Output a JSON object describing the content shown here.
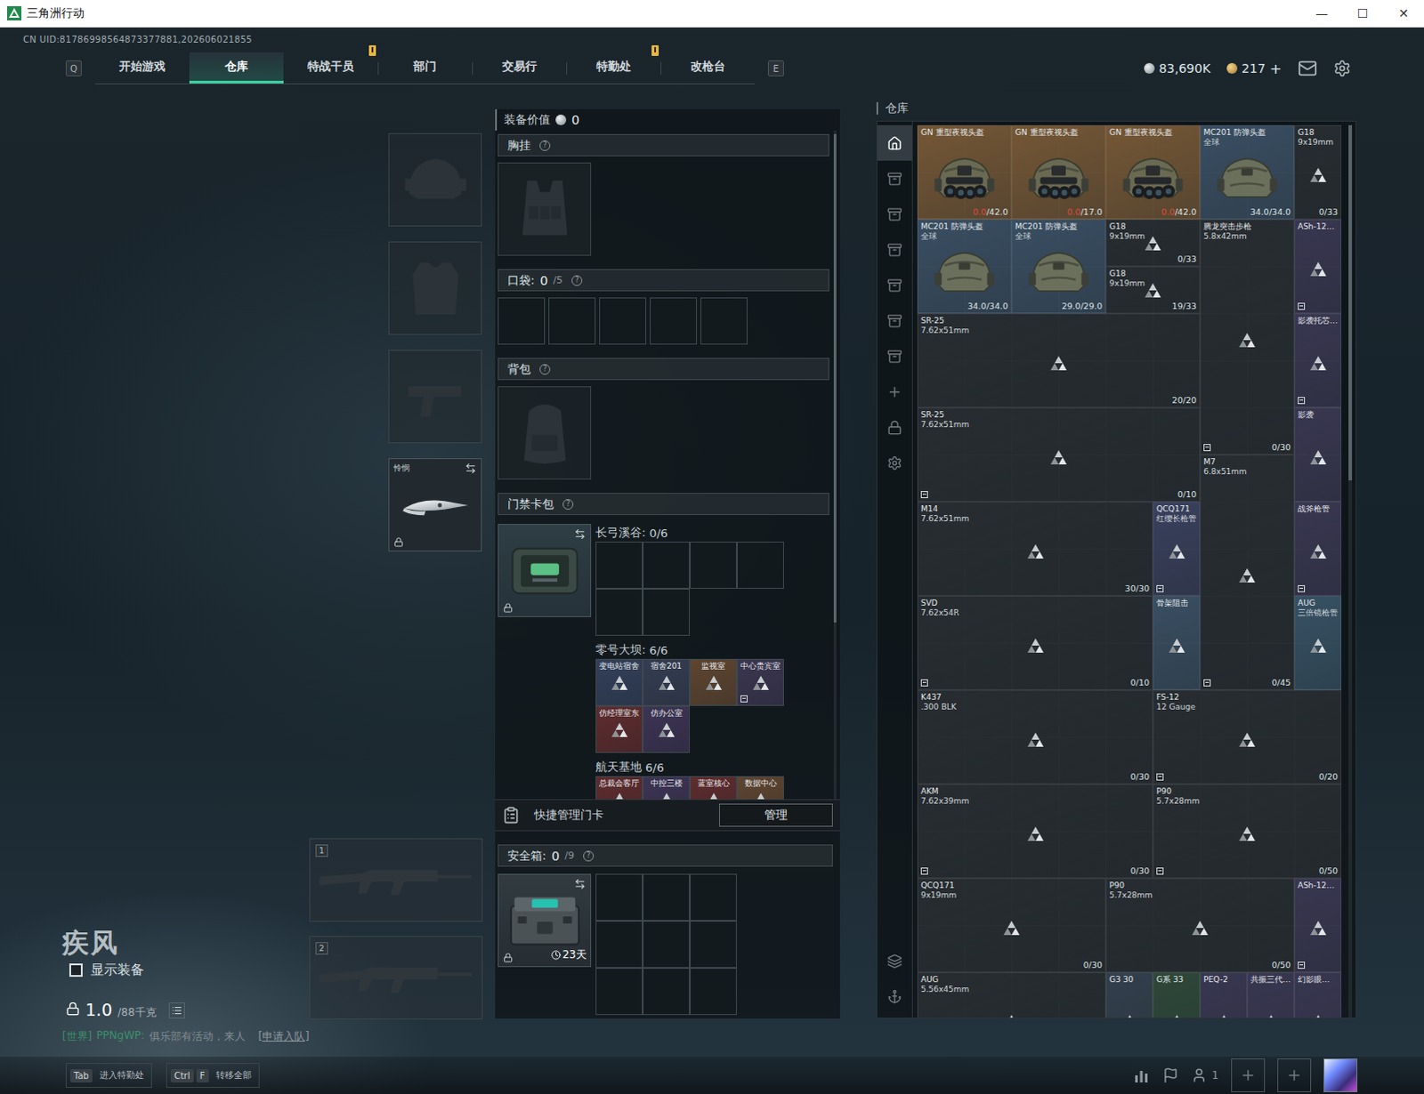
{
  "window": {
    "title": "三角洲行动",
    "controls": [
      "—",
      "☐",
      "✕"
    ]
  },
  "uid": "CN UID:81786998564873377881,202606021855",
  "nav": {
    "prev_key": "Q",
    "next_key": "E",
    "tabs": [
      {
        "label": "开始游戏",
        "selected": false,
        "alert": false
      },
      {
        "label": "仓库",
        "selected": true,
        "alert": false
      },
      {
        "label": "特战干员",
        "selected": false,
        "alert": true
      },
      {
        "label": "部门",
        "selected": false,
        "alert": false
      },
      {
        "label": "交易行",
        "selected": false,
        "alert": false
      },
      {
        "label": "特勤处",
        "selected": false,
        "alert": true
      },
      {
        "label": "改枪台",
        "selected": false,
        "alert": false
      }
    ]
  },
  "currencies": [
    {
      "kind": "silver",
      "amount": "83,690K"
    },
    {
      "kind": "gold",
      "amount": "217",
      "action": "+"
    }
  ],
  "equipment": [
    {
      "kind": "helmet"
    },
    {
      "kind": "armor"
    },
    {
      "kind": "pistol"
    },
    {
      "kind": "melee",
      "label": "怜悯",
      "locked": true
    }
  ],
  "weapons": [
    {
      "slot": "1"
    },
    {
      "slot": "2"
    }
  ],
  "character": {
    "name": "疾风",
    "show_equipment": {
      "label": "显示装备",
      "checked": false
    },
    "weight": "1.0",
    "weight_max": "/88千克",
    "locked": true
  },
  "chat": {
    "channel": "[世界]",
    "user": "PPNgWP:",
    "message": "俱乐部有活动，来人",
    "action": "[申请入队]"
  },
  "loadout": {
    "value_label": "装备价值",
    "value": "0",
    "chest_rig": {
      "label": "胸挂",
      "help": "?"
    },
    "pockets": {
      "label": "口袋:",
      "count": "0",
      "capacity": "/5",
      "help": "?",
      "slots": [
        {
          "filled": false
        },
        {
          "filled": false
        },
        {
          "filled": false
        },
        {
          "filled": false
        },
        {
          "filled": false
        }
      ]
    },
    "backpack": {
      "label": "背包",
      "help": "?"
    },
    "keycards": {
      "label": "门禁卡包",
      "help": "?",
      "locked": true,
      "maps": [
        {
          "name": "长弓溪谷:",
          "count": "0/6",
          "cards": [
            {
              "filled": false
            },
            {
              "filled": false
            },
            {
              "filled": false
            },
            {
              "filled": false
            },
            {
              "filled": false
            },
            {
              "filled": false
            }
          ]
        },
        {
          "name": "零号大坝:",
          "count": "6/6",
          "cards": [
            {
              "filled": true,
              "name": "变电站宿舍",
              "color": "#33405a",
              "marked": false
            },
            {
              "filled": true,
              "name": "宿舍201",
              "color": "#353d52",
              "marked": false
            },
            {
              "filled": true,
              "name": "监视室",
              "color": "#5e4530",
              "marked": false
            },
            {
              "filled": true,
              "name": "中心贵宾室",
              "color": "#3b3650",
              "marked": true
            },
            {
              "filled": true,
              "name": "仿经理室东",
              "color": "#5e2c2e",
              "marked": false
            },
            {
              "filled": true,
              "name": "仿办公室",
              "color": "#3d3454",
              "marked": false
            }
          ]
        },
        {
          "name": "航天基地",
          "count": "6/6",
          "cards": [
            {
              "filled": true,
              "name": "总裁会客厅",
              "color": "#5e2c2e",
              "marked": false
            },
            {
              "filled": true,
              "name": "中控三楼",
              "color": "#3d3454",
              "marked": false
            },
            {
              "filled": true,
              "name": "蓝室核心",
              "color": "#5e2c2e",
              "marked": false
            },
            {
              "filled": true,
              "name": "数据中心",
              "color": "#5e4530",
              "marked": false
            }
          ]
        }
      ]
    },
    "quick_manage": {
      "label": "快捷管理门卡",
      "button": "管理"
    },
    "safe_box": {
      "label": "安全箱:",
      "count": "0",
      "capacity": "/9",
      "help": "?",
      "days": "23天",
      "locked": true,
      "slots": [
        {
          "filled": false
        },
        {
          "filled": false
        },
        {
          "filled": false
        },
        {
          "filled": false
        },
        {
          "filled": false
        },
        {
          "filled": false
        },
        {
          "filled": false
        },
        {
          "filled": false
        },
        {
          "filled": false
        }
      ]
    }
  },
  "stash": {
    "label": "仓库",
    "tabs": [
      {
        "kind": "home",
        "selected": true
      },
      {
        "kind": "tab",
        "selected": false
      },
      {
        "kind": "tab",
        "selected": false
      },
      {
        "kind": "tab",
        "selected": false
      },
      {
        "kind": "tab",
        "selected": false
      },
      {
        "kind": "tab",
        "selected": false
      },
      {
        "kind": "tab",
        "selected": false
      },
      {
        "kind": "add",
        "selected": false
      },
      {
        "kind": "lock",
        "selected": false
      },
      {
        "kind": "settings",
        "selected": false
      },
      {
        "kind": "layers",
        "selected": false
      },
      {
        "kind": "transfer",
        "selected": false
      }
    ],
    "items": [
      {
        "name": "GN 重型夜视头盔",
        "kind": "nvg_helmet",
        "color": "#7a5a36",
        "count_low": "0.0",
        "count": "/42.0",
        "marked": false
      },
      {
        "name": "GN 重型夜视头盔",
        "kind": "nvg_helmet",
        "color": "#7a5a36",
        "count_low": "0.0",
        "count": "/17.0",
        "marked": false
      },
      {
        "name": "GN 重型夜视头盔",
        "kind": "nvg_helmet",
        "color": "#7a5a36",
        "count_low": "0.0",
        "count": "/42.0",
        "marked": false
      },
      {
        "name": "MC201 防弹头盔",
        "sub": "全球",
        "kind": "helmet",
        "color": "#3b5166",
        "count": "34.0/34.0",
        "marked": false
      },
      {
        "name": "G18",
        "sub": "9x19mm",
        "kind": "gun",
        "color": "#272d31",
        "count": "0/33",
        "marked": false
      },
      {
        "name": "MC201 防弹头盔",
        "sub": "全球",
        "kind": "helmet",
        "color": "#3b5166",
        "count": "34.0/34.0",
        "marked": false
      },
      {
        "name": "MC201 防弹头盔",
        "sub": "全球",
        "kind": "helmet",
        "color": "#3b5166",
        "count": "29.0/29.0",
        "marked": false
      },
      {
        "name": "G18",
        "sub": "9x19mm",
        "kind": "gun",
        "color": "#272d31",
        "count": "0/33",
        "marked": false
      },
      {
        "name": "G18",
        "sub": "9x19mm",
        "kind": "gun",
        "color": "#272d31",
        "count": "19/33",
        "marked": false
      },
      {
        "name": "腾龙突击步枪",
        "sub": "5.8x42mm",
        "kind": "gun",
        "color": "#272d31",
        "count": "0/30",
        "marked": true
      },
      {
        "name": "ASh-12…",
        "kind": "part",
        "color": "#3a3854",
        "marked": true
      },
      {
        "name": "影袭托芯…",
        "kind": "part",
        "color": "#3a3854",
        "marked": true
      },
      {
        "name": "影袭",
        "kind": "part",
        "color": "#3a3854",
        "marked": false
      },
      {
        "name": "SR-25",
        "sub": "7.62x51mm",
        "kind": "gun",
        "color": "#272d31",
        "count": "20/20",
        "marked": false
      },
      {
        "name": "SR-25",
        "sub": "7.62x51mm",
        "kind": "gun",
        "color": "#272d31",
        "count": "0/10",
        "marked": true
      },
      {
        "name": "M7",
        "sub": "6.8x51mm",
        "kind": "gun",
        "color": "#272d31",
        "count": "0/45",
        "marked": true
      },
      {
        "name": "M14",
        "sub": "7.62x51mm",
        "kind": "gun",
        "color": "#272d31",
        "count": "30/30",
        "marked": false
      },
      {
        "name": "QCQ171",
        "sub": "红缨长枪管",
        "kind": "part",
        "color": "#3b4260",
        "marked": true
      },
      {
        "name": "战斧枪管",
        "kind": "part",
        "color": "#3a3854",
        "marked": true
      },
      {
        "name": "SVD",
        "sub": "7.62x54R",
        "kind": "gun",
        "color": "#272d31",
        "count": "0/10",
        "marked": true
      },
      {
        "name": "骨架阻击",
        "kind": "part",
        "color": "#3b5166",
        "marked": false
      },
      {
        "name": "AUG",
        "sub": "三倍镜枪管",
        "kind": "part",
        "color": "#385468",
        "marked": false
      },
      {
        "name": "K437",
        "sub": ".300 BLK",
        "kind": "gun",
        "color": "#272d31",
        "count": "0/30",
        "marked": false
      },
      {
        "name": "FS-12",
        "sub": "12 Gauge",
        "kind": "gun",
        "color": "#272d31",
        "count": "0/20",
        "marked": true
      },
      {
        "name": "AKM",
        "sub": "7.62x39mm",
        "kind": "gun",
        "color": "#272d31",
        "count": "0/30",
        "marked": true
      },
      {
        "name": "P90",
        "sub": "5.7x28mm",
        "kind": "gun",
        "color": "#272d31",
        "count": "0/50",
        "marked": true
      },
      {
        "name": "QCQ171",
        "sub": "9x19mm",
        "kind": "gun",
        "color": "#272d31",
        "count": "0/30",
        "marked": false
      },
      {
        "name": "P90",
        "sub": "5.7x28mm",
        "kind": "gun",
        "color": "#272d31",
        "count": "0/50",
        "marked": false
      },
      {
        "name": "ASh-12…",
        "kind": "part",
        "color": "#3a3854",
        "marked": true
      },
      {
        "name": "AUG",
        "sub": "5.56x45mm",
        "kind": "gun",
        "color": "#272d31",
        "marked": false
      },
      {
        "name": "G3 30",
        "kind": "part",
        "color": "#34414f",
        "marked": false
      },
      {
        "name": "G系 33",
        "kind": "part",
        "color": "#2f4a3a",
        "marked": false
      },
      {
        "name": "PEQ-2",
        "kind": "part",
        "color": "#3a3854",
        "marked": false
      },
      {
        "name": "共振三代…",
        "kind": "part",
        "color": "#3a3854",
        "marked": false
      },
      {
        "name": "幻影眼…",
        "kind": "part",
        "color": "#3a3854",
        "marked": false
      }
    ]
  },
  "hotkeys": [
    {
      "keys": [
        "Tab"
      ],
      "label": "进入特勤处"
    },
    {
      "keys": [
        "Ctrl",
        "F"
      ],
      "label": "转移全部"
    }
  ],
  "social": {
    "party_count": "1",
    "invite_slots": [
      {
        "filled": false
      },
      {
        "filled": false
      }
    ]
  }
}
